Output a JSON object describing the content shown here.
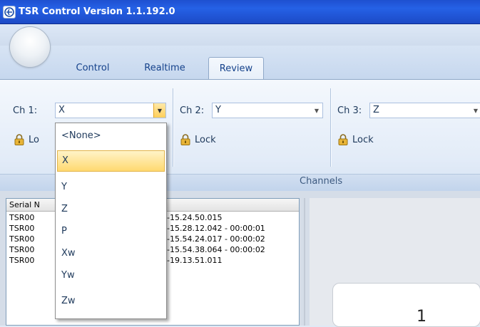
{
  "window": {
    "title": "TSR Control Version 1.1.192.0"
  },
  "tabs": [
    {
      "label": "Control",
      "active": false
    },
    {
      "label": "Realtime",
      "active": false
    },
    {
      "label": "Review",
      "active": true
    }
  ],
  "channels": {
    "group_label": "Channels",
    "ch1": {
      "label": "Ch 1:",
      "value": "X",
      "lock_label": "Lo"
    },
    "ch2": {
      "label": "Ch 2:",
      "value": "Y",
      "lock_label": "Lock"
    },
    "ch3": {
      "label": "Ch 3:",
      "value": "Z",
      "lock_label": "Lock"
    }
  },
  "dropdown": {
    "options": [
      "<None>",
      "X",
      "Y",
      "Z",
      "P",
      "Xw",
      "Yw",
      "Zw"
    ],
    "selected": "X"
  },
  "list": {
    "header": "Serial N",
    "rows": [
      {
        "serial": "TSR00",
        "time": "3-15.24.50.015"
      },
      {
        "serial": "TSR00",
        "time": "3-15.28.12.042 - 00:00:01"
      },
      {
        "serial": "TSR00",
        "time": "3-15.54.24.017 - 00:00:02"
      },
      {
        "serial": "TSR00",
        "time": "3-15.54.38.064 - 00:00:02"
      },
      {
        "serial": "TSR00",
        "time": "3-19.13.51.011"
      }
    ]
  },
  "right_pane": {
    "card_text": "1"
  },
  "colors": {
    "accent": "#ffd970",
    "title_bar": "#2561e6",
    "ribbon": "#e3ecf8"
  }
}
